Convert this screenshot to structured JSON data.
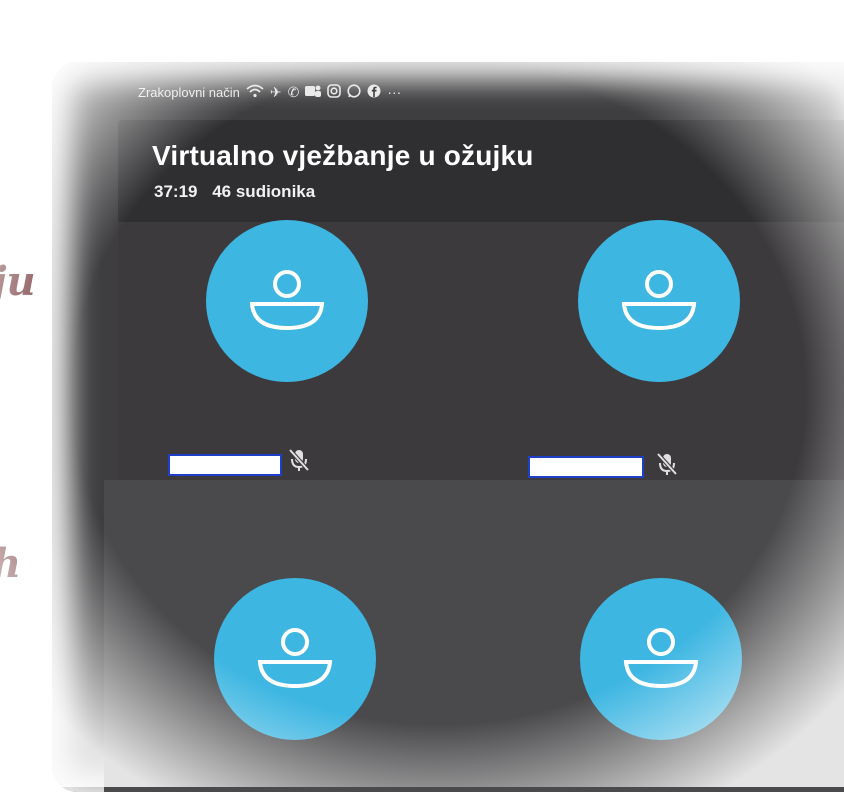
{
  "side_text": {
    "fragment_top": "ju",
    "fragment_bottom": "h"
  },
  "status_bar": {
    "mode_label": "Zrakoplovni način",
    "icons": [
      "wifi-icon",
      "airplane-icon",
      "phone-icon",
      "teams-icon",
      "instagram-icon",
      "whatsapp-icon",
      "facebook-icon",
      "more-icon"
    ],
    "more_text": "···"
  },
  "meeting": {
    "title": "Virtualno vježbanje u ožujku",
    "duration": "37:19",
    "participants": "46 sudionika"
  },
  "tiles": [
    {
      "name_visible": "",
      "muted": true
    },
    {
      "name_visible": "",
      "muted": true
    },
    {
      "name_visible": "",
      "muted": true
    },
    {
      "name_visible": "",
      "muted": true
    }
  ],
  "colors": {
    "avatar": "#3db6e2",
    "header_bg": "#2f2e30",
    "stage_bg": "#3c3a3c",
    "side_text": "#6b2a2e"
  }
}
